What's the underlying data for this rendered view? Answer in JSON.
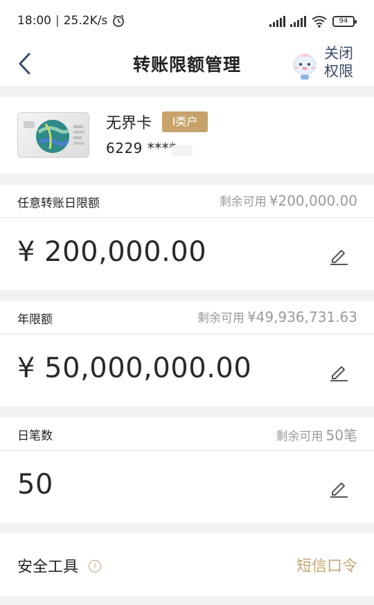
{
  "status": {
    "time": "18:00",
    "speed": "25.2K/s",
    "battery": "94"
  },
  "nav": {
    "title": "转账限额管理",
    "close_line1": "关闭",
    "close_line2": "权限"
  },
  "card": {
    "name": "无界卡",
    "badge": "I类户",
    "number": "6229 ****"
  },
  "limits": [
    {
      "label": "任意转账日限额",
      "remain_prefix": "剩余可用",
      "remain_value": "¥200,000.00",
      "value": "¥ 200,000.00"
    },
    {
      "label": "年限额",
      "remain_prefix": "剩余可用",
      "remain_value": "¥49,936,731.63",
      "value": "¥ 50,000,000.00"
    },
    {
      "label": "日笔数",
      "remain_prefix": "剩余可用",
      "remain_value": "50笔",
      "value": "50"
    }
  ],
  "tools": {
    "label": "安全工具",
    "info_icon": "i",
    "link": "短信口令"
  },
  "colors": {
    "accent_gold": "#c4a572",
    "badge_gold": "#c7a36b",
    "background": "#f2f2f2"
  },
  "icons": [
    "alarm-icon",
    "signal-icon",
    "wifi-icon",
    "battery-icon",
    "back-icon",
    "mascot-icon",
    "edit-icon",
    "info-icon"
  ]
}
